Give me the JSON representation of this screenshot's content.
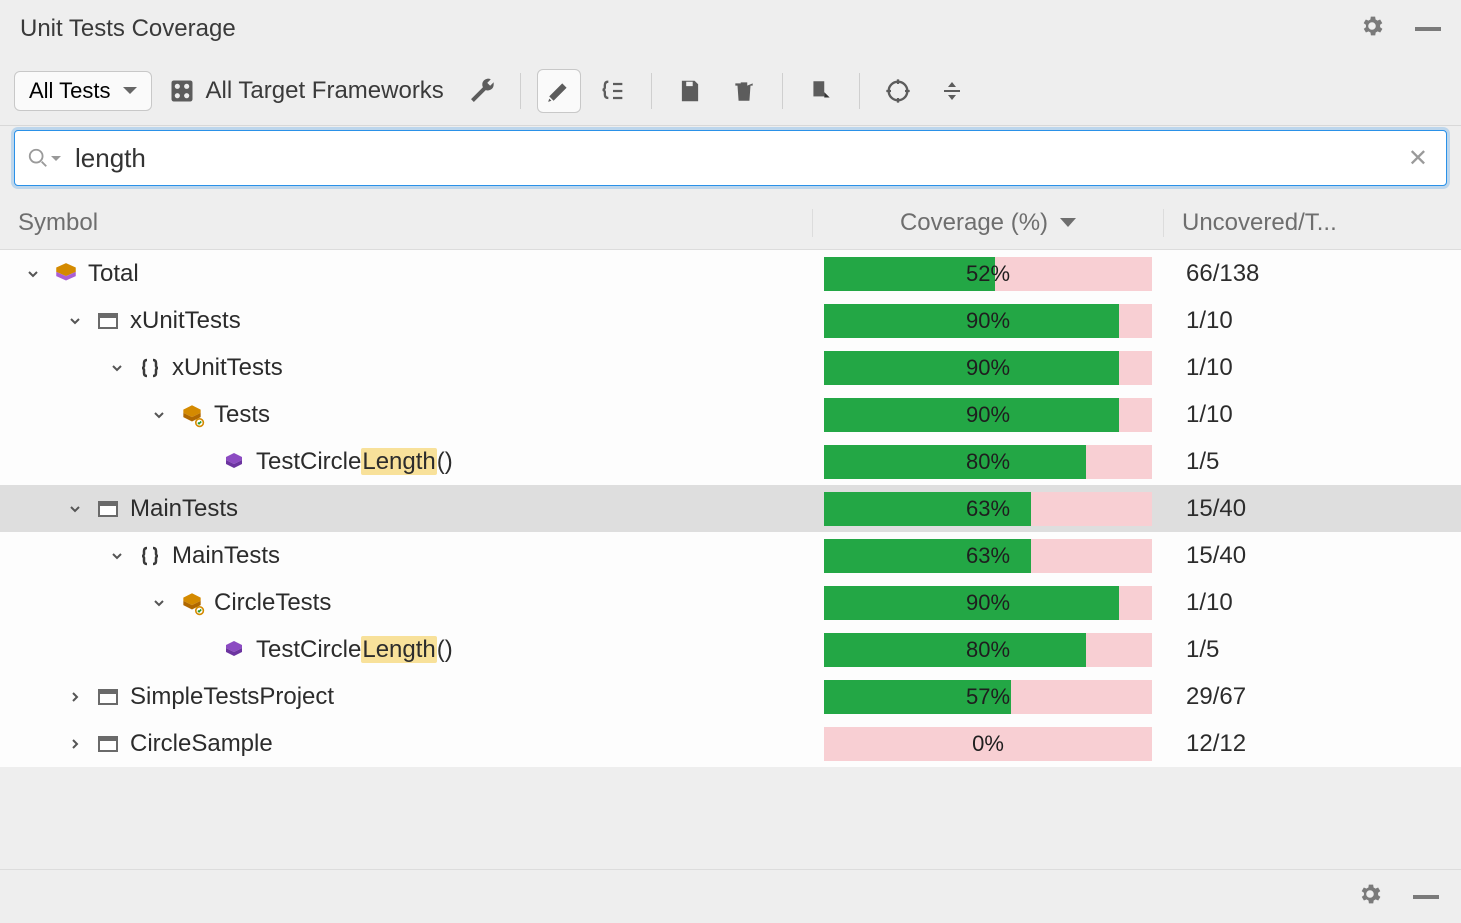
{
  "title": "Unit Tests Coverage",
  "toolbar": {
    "scope_dropdown": "All Tests",
    "frameworks_label": "All Target Frameworks"
  },
  "search": {
    "value": "length",
    "placeholder": ""
  },
  "columns": {
    "symbol": "Symbol",
    "coverage": "Coverage (%)",
    "uncovered": "Uncovered/T..."
  },
  "rows": [
    {
      "depth": 0,
      "expander": "open",
      "icon": "total",
      "label_pre": "Total",
      "label_hl": "",
      "label_post": "",
      "coverage": 52,
      "uncovered": "66/138",
      "highlight": false
    },
    {
      "depth": 1,
      "expander": "open",
      "icon": "project",
      "label_pre": "xUnitTests",
      "label_hl": "",
      "label_post": "",
      "coverage": 90,
      "uncovered": "1/10",
      "highlight": false
    },
    {
      "depth": 2,
      "expander": "open",
      "icon": "namespace",
      "label_pre": "xUnitTests",
      "label_hl": "",
      "label_post": "",
      "coverage": 90,
      "uncovered": "1/10",
      "highlight": false
    },
    {
      "depth": 3,
      "expander": "open",
      "icon": "class",
      "label_pre": "Tests",
      "label_hl": "",
      "label_post": "",
      "coverage": 90,
      "uncovered": "1/10",
      "highlight": false
    },
    {
      "depth": 4,
      "expander": "none",
      "icon": "method",
      "label_pre": "TestCircle",
      "label_hl": "Length",
      "label_post": "()",
      "coverage": 80,
      "uncovered": "1/5",
      "highlight": false
    },
    {
      "depth": 1,
      "expander": "open",
      "icon": "project",
      "label_pre": "MainTests",
      "label_hl": "",
      "label_post": "",
      "coverage": 63,
      "uncovered": "15/40",
      "highlight": true
    },
    {
      "depth": 2,
      "expander": "open",
      "icon": "namespace",
      "label_pre": "MainTests",
      "label_hl": "",
      "label_post": "",
      "coverage": 63,
      "uncovered": "15/40",
      "highlight": false
    },
    {
      "depth": 3,
      "expander": "open",
      "icon": "class",
      "label_pre": "CircleTests",
      "label_hl": "",
      "label_post": "",
      "coverage": 90,
      "uncovered": "1/10",
      "highlight": false
    },
    {
      "depth": 4,
      "expander": "none",
      "icon": "method",
      "label_pre": "TestCircle",
      "label_hl": "Length",
      "label_post": "()",
      "coverage": 80,
      "uncovered": "1/5",
      "highlight": false
    },
    {
      "depth": 1,
      "expander": "closed",
      "icon": "project",
      "label_pre": "SimpleTestsProject",
      "label_hl": "",
      "label_post": "",
      "coverage": 57,
      "uncovered": "29/67",
      "highlight": false
    },
    {
      "depth": 1,
      "expander": "closed",
      "icon": "project",
      "label_pre": "CircleSample",
      "label_hl": "",
      "label_post": "",
      "coverage": 0,
      "uncovered": "12/12",
      "highlight": false
    }
  ]
}
